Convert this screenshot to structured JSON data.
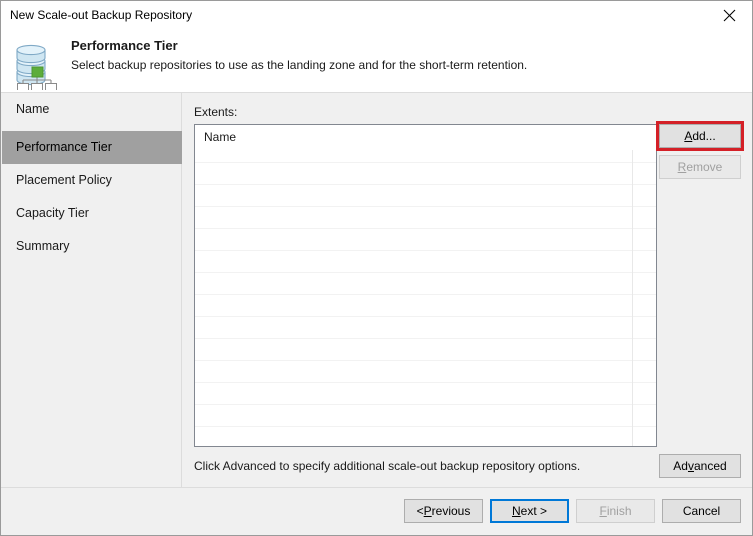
{
  "window": {
    "title": "New Scale-out Backup Repository",
    "close_icon": "close-icon"
  },
  "header": {
    "icon": "scale-out-repository-icon",
    "title": "Performance Tier",
    "subtitle": "Select backup repositories to use as the landing zone and for the short-term retention."
  },
  "sidebar": {
    "items": [
      {
        "label": "Name",
        "selected": false
      },
      {
        "label": "Performance Tier",
        "selected": true
      },
      {
        "label": "Placement Policy",
        "selected": false
      },
      {
        "label": "Capacity Tier",
        "selected": false
      },
      {
        "label": "Summary",
        "selected": false
      }
    ]
  },
  "main": {
    "extents_label": "Extents:",
    "list": {
      "columns": [
        "Name"
      ],
      "rows": []
    },
    "add_label": "Add...",
    "add_accesskey": "A",
    "remove_label": "Remove",
    "remove_accesskey": "R",
    "remove_disabled": true,
    "advanced_hint": "Click Advanced to specify additional scale-out backup repository options.",
    "advanced_label": "Advanced",
    "advanced_accesskey": "v",
    "highlight_color": "#d42027",
    "highlight_target": "Add..."
  },
  "footer": {
    "previous_label": "< Previous",
    "previous_accesskey": "P",
    "next_label": "Next >",
    "next_accesskey": "N",
    "next_is_default": true,
    "finish_label": "Finish",
    "finish_accesskey": "F",
    "finish_disabled": true,
    "cancel_label": "Cancel"
  }
}
